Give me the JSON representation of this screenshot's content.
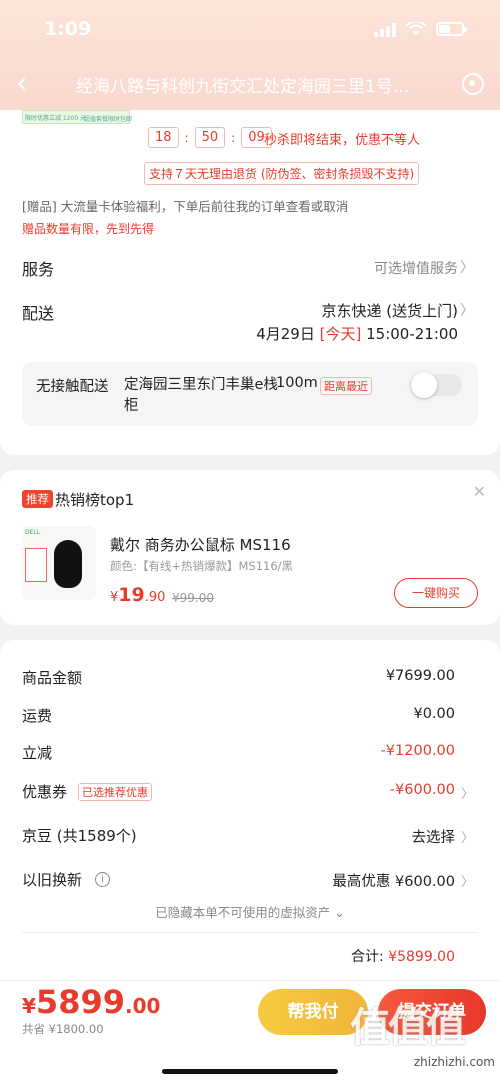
{
  "status_bar": {
    "time": "1:09"
  },
  "nav": {
    "title": "经海八路与科创九街交汇处定海园三里1号..."
  },
  "promo": {
    "thumb_text": "限时优惠立减 1200 元",
    "thumb_text2": "超值套餐限时包邮",
    "countdown": [
      "18",
      "50",
      "09"
    ],
    "countdown_text": "秒杀即将结束，优惠不等人",
    "return_policy": "支持７天无理由退货 (防伪签、密封条损毁不支持)",
    "gift_note": "[赠品] 大流量卡体验福利，下单后前往我的订单查看或取消",
    "gift_warn": "赠品数量有限，先到先得"
  },
  "service": {
    "label": "服务",
    "value": "可选增值服务"
  },
  "shipping": {
    "label": "配送",
    "method": "京东快递 (送货上门)",
    "date": "4月29日",
    "today": "[今天]",
    "time": "15:00-21:00"
  },
  "contactless": {
    "label": "无接触配送",
    "address": "定海园三里东门丰巢e栈柜",
    "distance": "100m",
    "tag": "距离最近",
    "enabled": false
  },
  "recommend": {
    "badge": "推荐",
    "title": "热销榜top1",
    "product": {
      "name": "戴尔 商务办公鼠标 MS116",
      "spec": "颜色:【有线+热销爆款】MS116/黑",
      "price_symbol": "¥",
      "price_int": "19",
      "price_dec": ".90",
      "old_price": "¥99.00",
      "buy_label": "一键购买",
      "image_brand": "DELL"
    }
  },
  "fees": {
    "goods_label": "商品金额",
    "goods_value": "¥7699.00",
    "freight_label": "运费",
    "freight_value": "¥0.00",
    "discount_label": "立减",
    "discount_value": "-¥1200.00",
    "coupon_label": "优惠券",
    "coupon_tag": "已选推荐优惠",
    "coupon_value": "-¥600.00",
    "jingdou_label": "京豆 (共1589个)",
    "jingdou_value": "去选择",
    "tradein_label": "以旧换新",
    "tradein_value": "最高优惠 ¥600.00",
    "hidden_note": "已隐藏本单不可使用的虚拟资产 ⌄",
    "total_label": "合计:",
    "total_value": "¥5899.00"
  },
  "bottom": {
    "currency": "¥",
    "price_int": "5899",
    "price_dec": ".00",
    "saved": "共省 ¥1800.00",
    "help_label": "帮我付",
    "submit_label": "提交订单"
  },
  "watermark": {
    "logo": "值值值",
    "site": "zhizhizhi.com"
  },
  "colors": {
    "accent_red": "#e73c2c",
    "header_start": "#fce4d8",
    "help_yellow": "#f1b53a"
  }
}
